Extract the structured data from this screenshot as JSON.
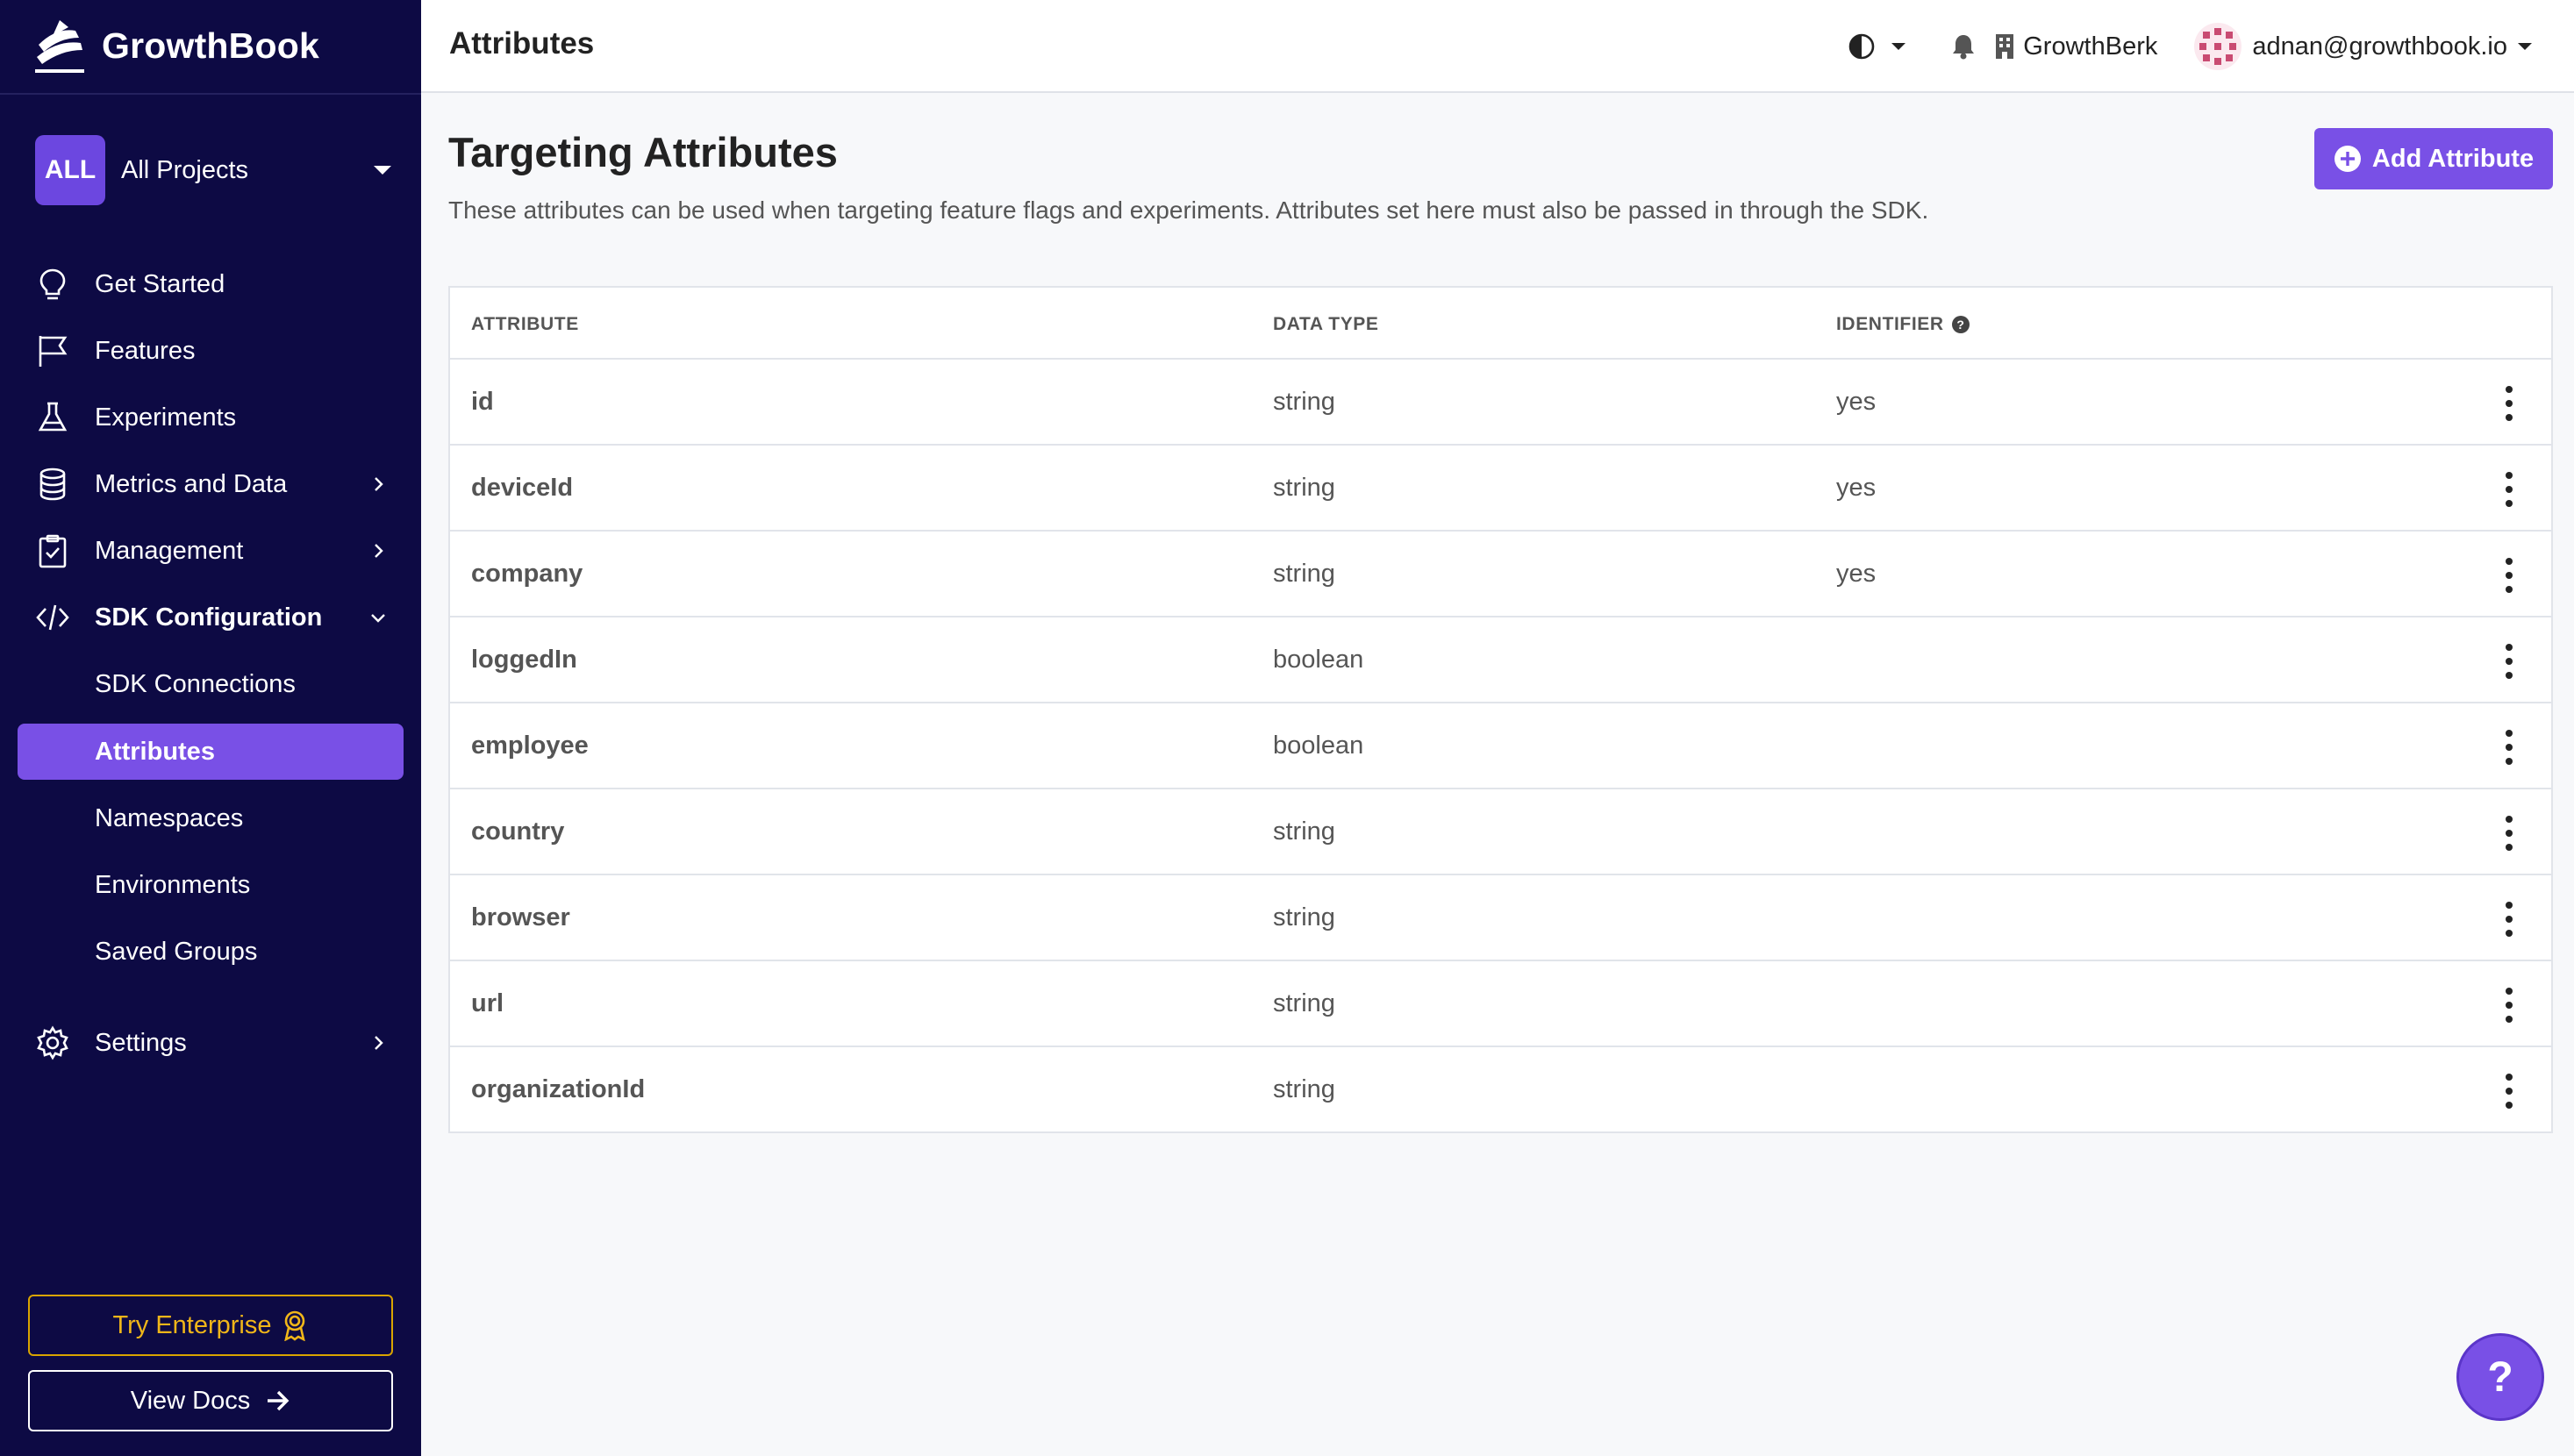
{
  "app": {
    "name": "GrowthBook"
  },
  "project_selector": {
    "badge": "ALL",
    "label": "All Projects"
  },
  "nav": {
    "items": [
      {
        "label": "Get Started",
        "icon": "lightbulb-icon"
      },
      {
        "label": "Features",
        "icon": "flag-icon"
      },
      {
        "label": "Experiments",
        "icon": "flask-icon"
      },
      {
        "label": "Metrics and Data",
        "icon": "database-icon"
      },
      {
        "label": "Management",
        "icon": "clipboard-icon"
      },
      {
        "label": "SDK Configuration",
        "icon": "code-icon"
      },
      {
        "label": "Settings",
        "icon": "gear-icon"
      }
    ],
    "sdk_sub": [
      {
        "label": "SDK Connections"
      },
      {
        "label": "Attributes"
      },
      {
        "label": "Namespaces"
      },
      {
        "label": "Environments"
      },
      {
        "label": "Saved Groups"
      }
    ]
  },
  "footer": {
    "enterprise_label": "Try Enterprise",
    "docs_label": "View Docs"
  },
  "topbar": {
    "title": "Attributes",
    "org": "GrowthBerk",
    "user": "adnan@growthbook.io"
  },
  "page": {
    "title": "Targeting Attributes",
    "description": "These attributes can be used when targeting feature flags and experiments. Attributes set here must also be passed in through the SDK.",
    "add_button": "Add Attribute"
  },
  "table": {
    "headers": {
      "attribute": "ATTRIBUTE",
      "data_type": "DATA TYPE",
      "identifier": "IDENTIFIER"
    },
    "rows": [
      {
        "attribute": "id",
        "data_type": "string",
        "identifier": "yes"
      },
      {
        "attribute": "deviceId",
        "data_type": "string",
        "identifier": "yes"
      },
      {
        "attribute": "company",
        "data_type": "string",
        "identifier": "yes"
      },
      {
        "attribute": "loggedIn",
        "data_type": "boolean",
        "identifier": ""
      },
      {
        "attribute": "employee",
        "data_type": "boolean",
        "identifier": ""
      },
      {
        "attribute": "country",
        "data_type": "string",
        "identifier": ""
      },
      {
        "attribute": "browser",
        "data_type": "string",
        "identifier": ""
      },
      {
        "attribute": "url",
        "data_type": "string",
        "identifier": ""
      },
      {
        "attribute": "organizationId",
        "data_type": "string",
        "identifier": ""
      }
    ]
  },
  "help": {
    "label": "?"
  },
  "colors": {
    "sidebar_bg": "#0d0a44",
    "accent": "#7950e6",
    "enterprise": "#f0b619"
  }
}
